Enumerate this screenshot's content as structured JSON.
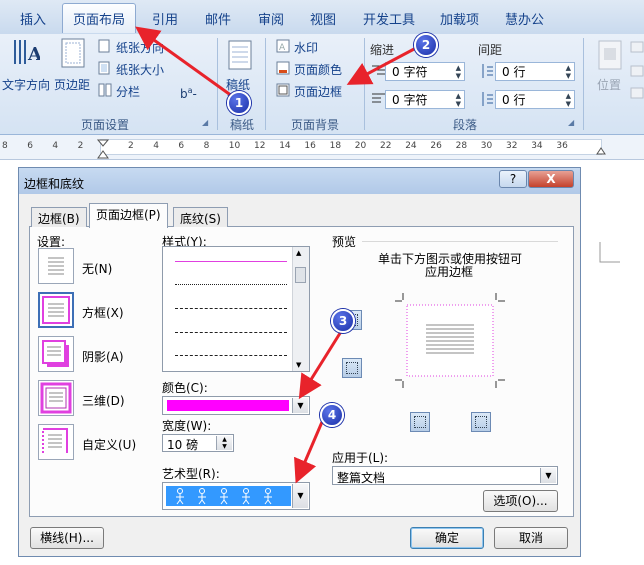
{
  "ribbon": {
    "tabs": [
      "插入",
      "页面布局",
      "引用",
      "邮件",
      "审阅",
      "视图",
      "开发工具",
      "加载项",
      "慧办公"
    ],
    "active_tab": "页面布局",
    "page_setup": {
      "text_direction": "文字方向",
      "margins": "页边距",
      "orientation": "纸张方向",
      "size": "纸张大小",
      "columns": "分栏",
      "group_label": "页面设置"
    },
    "draft": {
      "button": "稿纸\n设置",
      "btn_line1": "稿纸",
      "btn_line2": "设置",
      "group_label": "稿纸"
    },
    "background": {
      "watermark": "水印",
      "page_color": "页面颜色",
      "page_borders": "页面边框",
      "group_label": "页面背景"
    },
    "paragraph": {
      "indent": "缩进",
      "spacing": "间距",
      "indent_left": "0 字符",
      "indent_right": "0 字符",
      "spacing_before": "0 行",
      "spacing_after": "0 行",
      "group_label": "段落"
    },
    "arrange": {
      "position": "位置"
    }
  },
  "ruler": {
    "ticks": [
      "8",
      "6",
      "4",
      "2",
      "",
      "2",
      "4",
      "6",
      "8",
      "10",
      "12",
      "14",
      "16",
      "18",
      "20",
      "22",
      "24",
      "26",
      "28",
      "30",
      "32",
      "34",
      "36"
    ]
  },
  "dialog": {
    "title": "边框和底纹",
    "help": "?",
    "close": "X",
    "tabs": [
      "边框(B)",
      "页面边框(P)",
      "底纹(S)"
    ],
    "settings_label": "设置:",
    "settings": [
      "无(N)",
      "方框(X)",
      "阴影(A)",
      "三维(D)",
      "自定义(U)"
    ],
    "style_label": "样式(Y):",
    "color_label": "颜色(C):",
    "color_value": "#ff00ff",
    "width_label": "宽度(W):",
    "width_value": "10 磅",
    "art_label": "艺术型(R):",
    "preview_label": "预览",
    "preview_hint_1": "单击下方图示或使用按钮可",
    "preview_hint_2": "应用边框",
    "apply_to_label": "应用于(L):",
    "apply_to_value": "整篇文档",
    "options_button": "选项(O)...",
    "horizontal_line_button": "横线(H)...",
    "ok_button": "确定",
    "cancel_button": "取消"
  },
  "annotations": [
    "1",
    "2",
    "3",
    "4"
  ],
  "colors": {
    "accent": "#ff00ff",
    "arrow": "#e8232b",
    "badge": "#1a2fa8"
  }
}
